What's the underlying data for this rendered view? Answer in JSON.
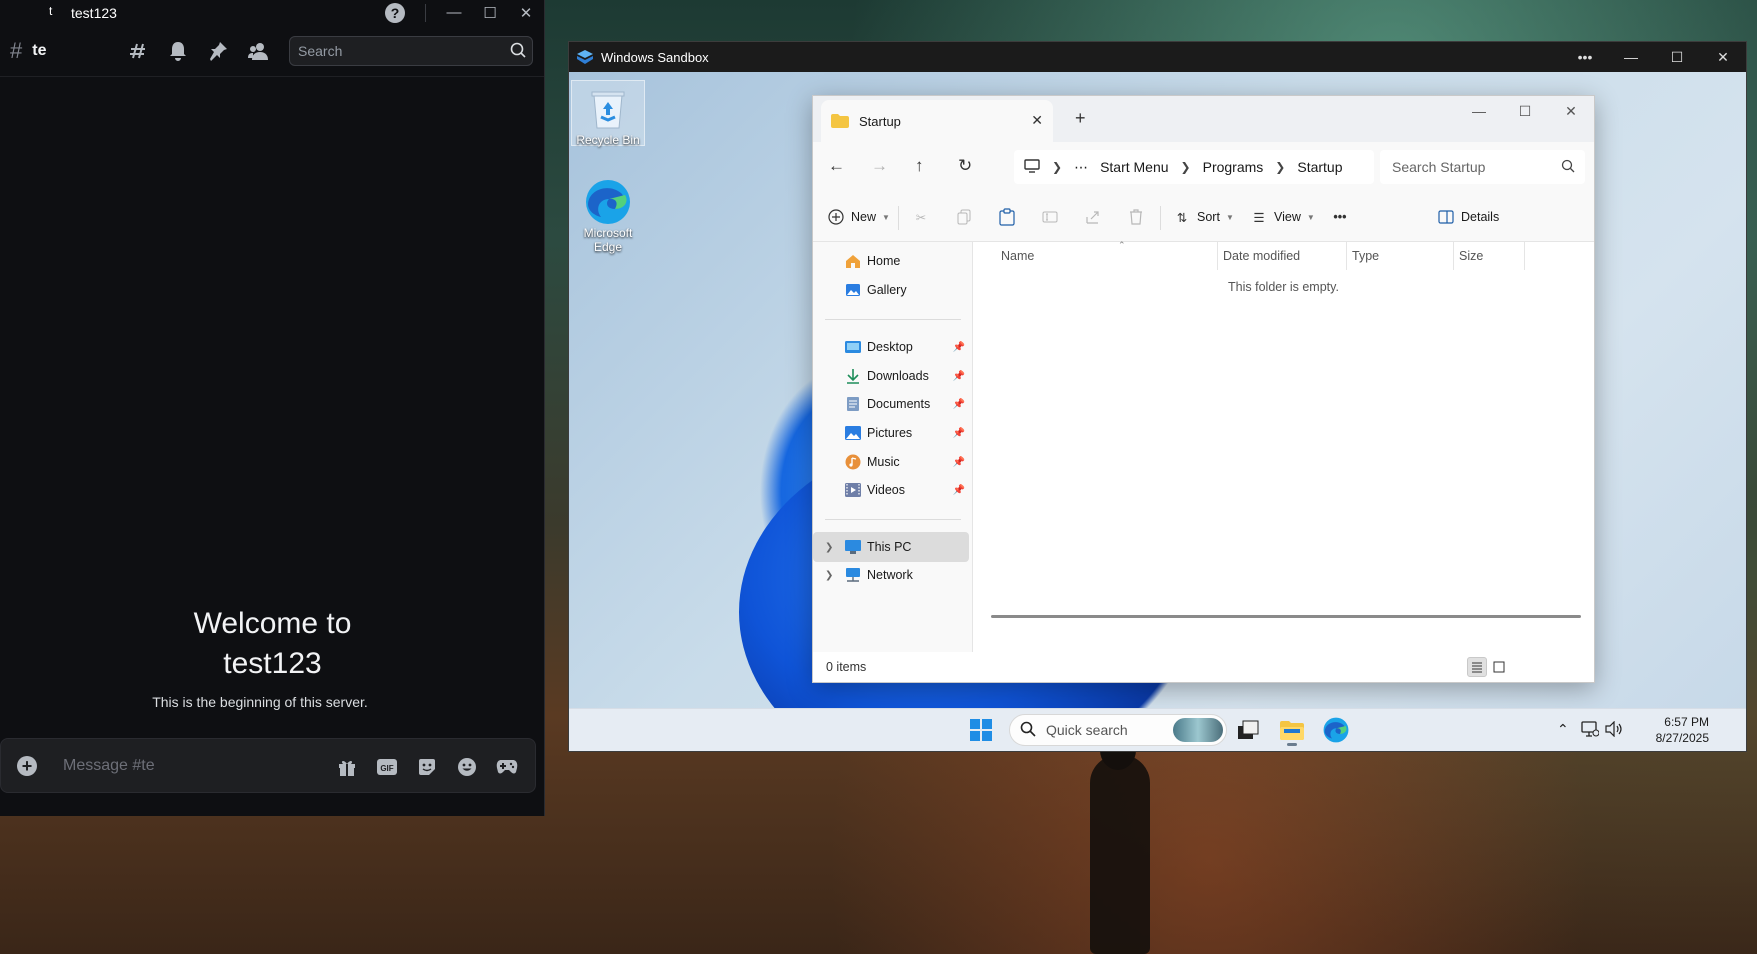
{
  "discord": {
    "app_glyph": "t",
    "window_title": "test123",
    "help_glyph": "?",
    "channel_hash": "#",
    "channel_name": "te",
    "search_placeholder": "Search",
    "welcome_line1": "Welcome to",
    "welcome_line2": "test123",
    "welcome_sub": "This is the beginning of this server.",
    "message_placeholder": "Message #te",
    "header_icons": [
      "threads-icon",
      "bell-icon",
      "pin-icon",
      "members-icon"
    ],
    "message_icons": [
      "gift-icon",
      "gif-icon",
      "sticker-icon",
      "emoji-icon",
      "game-controller-icon"
    ]
  },
  "sandbox": {
    "title": "Windows Sandbox",
    "desktop_icons": [
      {
        "label": "Recycle Bin",
        "icon": "recycle-bin-icon"
      },
      {
        "label": "Microsoft Edge",
        "icon": "edge-icon"
      }
    ]
  },
  "explorer": {
    "tab_title": "Startup",
    "breadcrumb": [
      "Start Menu",
      "Programs",
      "Startup"
    ],
    "search_placeholder": "Search Startup",
    "toolbar": {
      "new_label": "New",
      "sort_label": "Sort",
      "view_label": "View",
      "details_label": "Details"
    },
    "nav_top": [
      {
        "label": "Home",
        "icon": "home-icon"
      },
      {
        "label": "Gallery",
        "icon": "gallery-icon"
      }
    ],
    "nav_pinned": [
      {
        "label": "Desktop",
        "icon": "desktop-folder-icon"
      },
      {
        "label": "Downloads",
        "icon": "downloads-icon"
      },
      {
        "label": "Documents",
        "icon": "documents-icon"
      },
      {
        "label": "Pictures",
        "icon": "pictures-icon"
      },
      {
        "label": "Music",
        "icon": "music-icon"
      },
      {
        "label": "Videos",
        "icon": "videos-icon"
      }
    ],
    "nav_bottom": [
      {
        "label": "This PC",
        "icon": "this-pc-icon",
        "selected": true
      },
      {
        "label": "Network",
        "icon": "network-icon",
        "selected": false
      }
    ],
    "columns": [
      "Name",
      "Date modified",
      "Type",
      "Size"
    ],
    "empty_message": "This folder is empty.",
    "status_items": "0 items"
  },
  "taskbar": {
    "search_placeholder": "Quick search",
    "time": "6:57 PM",
    "date": "8/27/2025"
  },
  "colors": {
    "discord_bg": "#0e0f12",
    "explorer_accent": "#0a64c8",
    "folder_yellow": "#f4c542",
    "edge_blue": "#1aa3e8"
  }
}
